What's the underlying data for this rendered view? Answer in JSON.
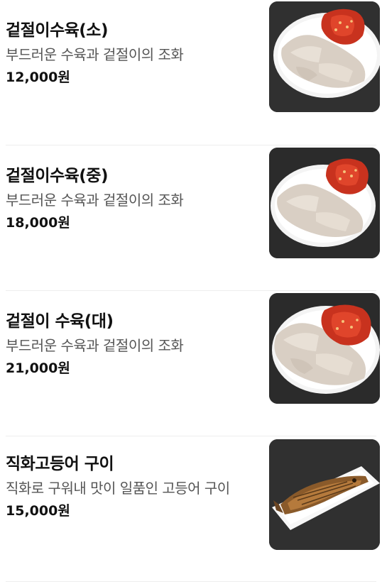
{
  "menu": {
    "items": [
      {
        "name": "겉절이수육(소)",
        "description": "부드러운 수육과 겉절이의 조화",
        "price": "12,000원",
        "image_icon": "bossam-plate-icon"
      },
      {
        "name": "겉절이수육(중)",
        "description": "부드러운 수육과 겉절이의 조화",
        "price": "18,000원",
        "image_icon": "bossam-plate-icon"
      },
      {
        "name": "겉절이 수육(대)",
        "description": "부드러운 수육과 겉절이의 조화",
        "price": "21,000원",
        "image_icon": "bossam-plate-icon"
      },
      {
        "name": "직화고등어 구이",
        "description": "직화로 구워내 맛이 일품인 고등어 구이",
        "price": "15,000원",
        "image_icon": "grilled-mackerel-icon"
      }
    ]
  },
  "colors": {
    "background": "#ffffff",
    "title": "#111111",
    "description": "#555555",
    "divider": "#eeeeee",
    "photo_background": "#2b2b2b"
  }
}
